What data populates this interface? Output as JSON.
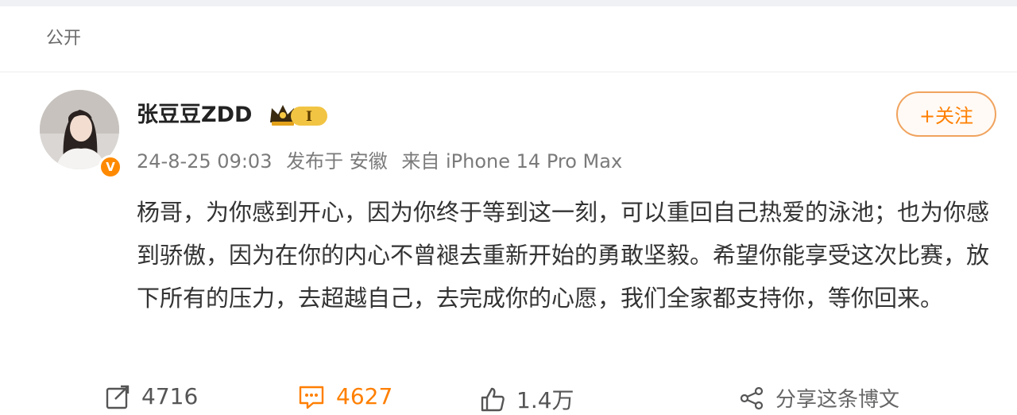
{
  "visibility": {
    "label": "公开"
  },
  "author": {
    "name": "张豆豆ZDD",
    "vip_badge_text": "I",
    "verified_badge_text": "V"
  },
  "follow_button": {
    "label": "+关注"
  },
  "meta": {
    "time": "24-8-25 09:03",
    "location": "发布于 安徽",
    "device": "来自 iPhone 14 Pro Max"
  },
  "post": {
    "text": "杨哥，为你感到开心，因为你终于等到这一刻，可以重回自己热爱的泳池；也为你感到骄傲，因为在你的内心不曾褪去重新开始的勇敢坚毅。希望你能享受这次比赛，放下所有的压力，去超越自己，去完成你的心愿，我们全家都支持你，等你回来。"
  },
  "stats": {
    "repost_count": "4716",
    "comment_count": "4627",
    "like_count": "1.4万",
    "share_label": "分享这条博文"
  },
  "colors": {
    "accent": "#ff7f00",
    "follow_border": "#f0a35e",
    "verified": "#ff8a00"
  },
  "icons": [
    "repost-icon",
    "comment-icon",
    "like-icon",
    "share-icon",
    "crown-icon",
    "verified-v-icon"
  ]
}
